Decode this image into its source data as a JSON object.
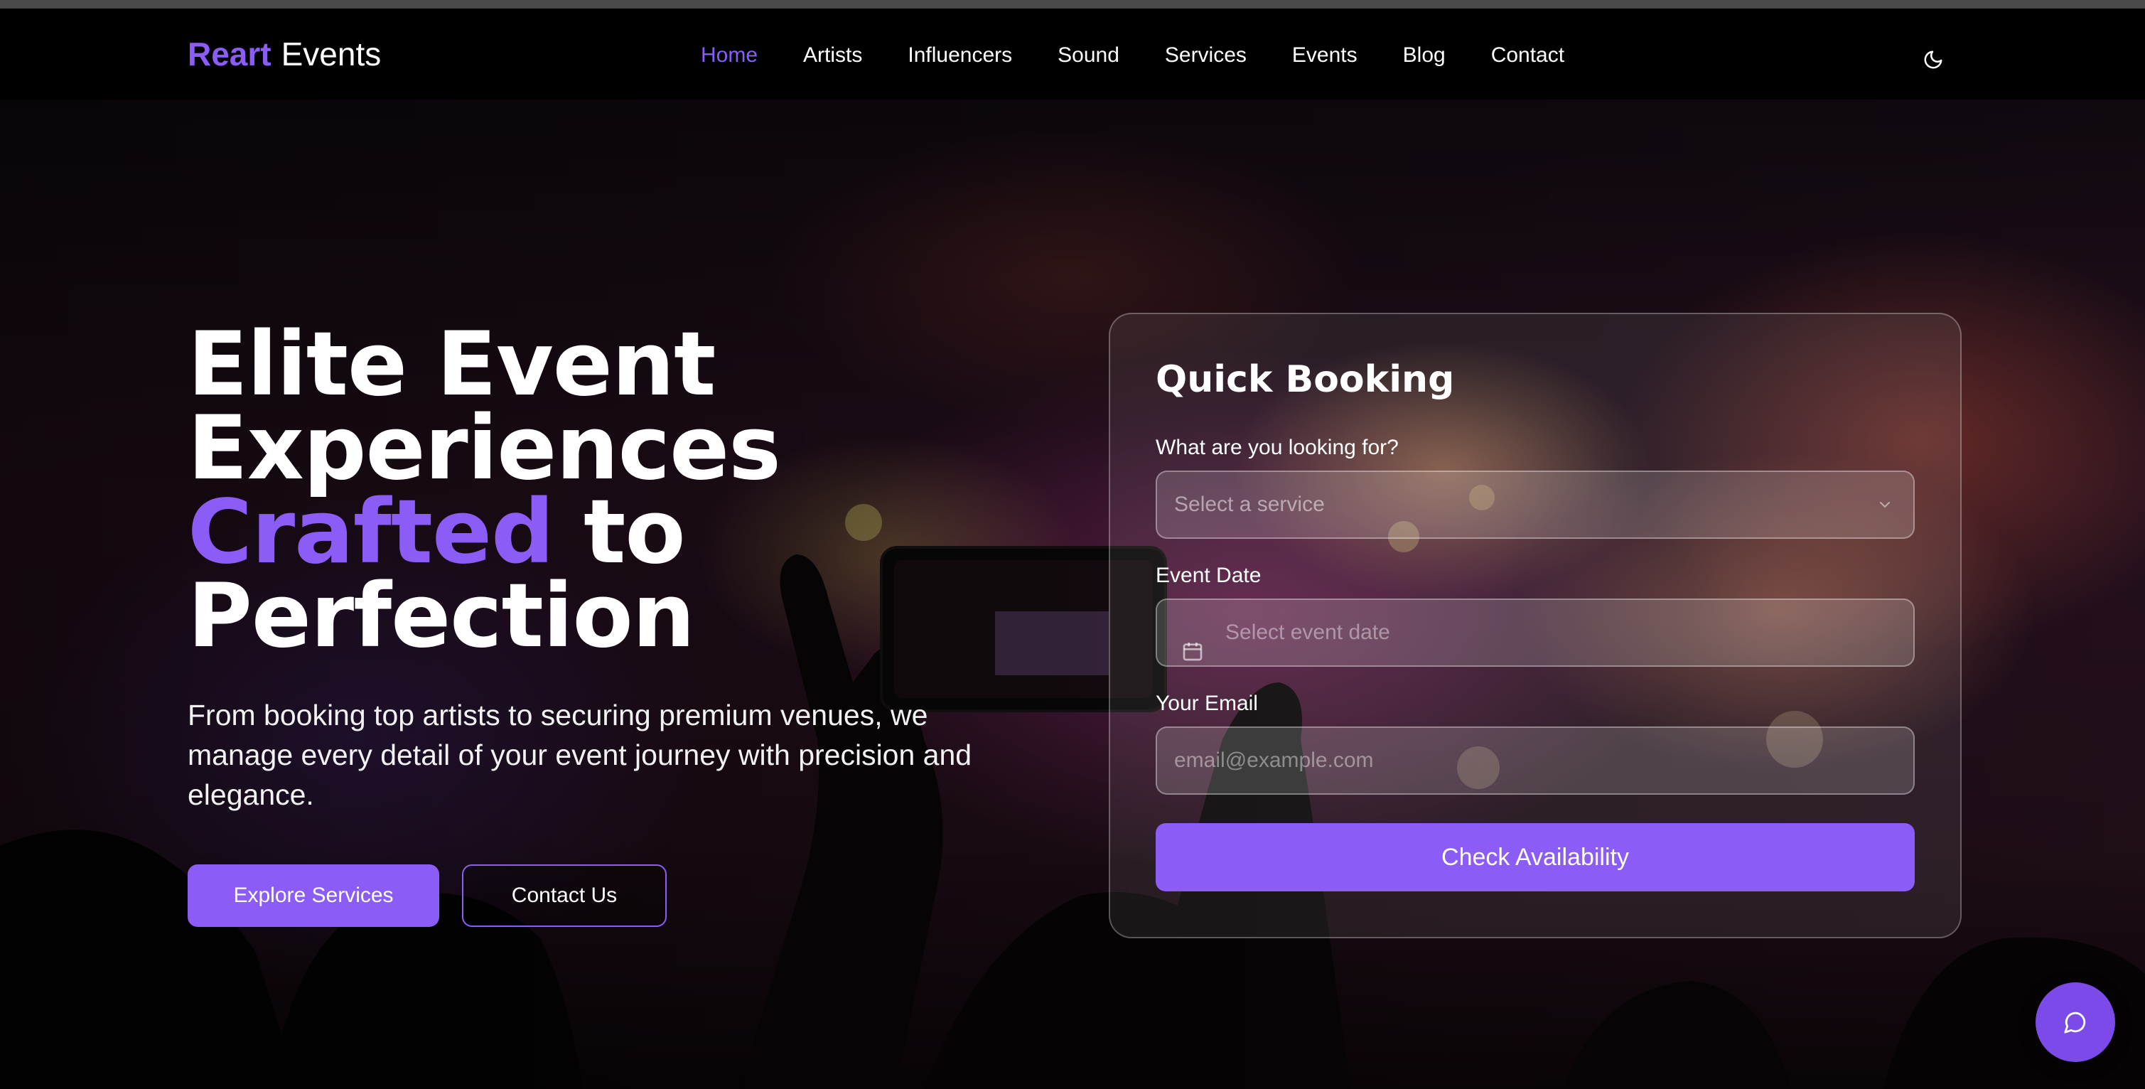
{
  "brand": {
    "name": "Reart",
    "suffix": "Events"
  },
  "nav": {
    "items": [
      {
        "label": "Home",
        "active": true
      },
      {
        "label": "Artists"
      },
      {
        "label": "Influencers"
      },
      {
        "label": "Sound"
      },
      {
        "label": "Services"
      },
      {
        "label": "Events"
      },
      {
        "label": "Blog"
      },
      {
        "label": "Contact"
      }
    ],
    "theme_toggle_icon": "moon-icon"
  },
  "hero": {
    "title_line1": "Elite Event",
    "title_line2": "Experiences",
    "title_accent": "Crafted",
    "title_after_accent": "to",
    "title_line4": "Perfection",
    "subtitle": "From booking top artists to securing premium venues, we manage every detail of your event journey with precision and elegance.",
    "primary_cta": "Explore Services",
    "secondary_cta": "Contact Us"
  },
  "booking": {
    "title": "Quick Booking",
    "service_label": "What are you looking for?",
    "service_placeholder": "Select a service",
    "date_label": "Event Date",
    "date_placeholder": "Select event date",
    "email_label": "Your Email",
    "email_placeholder": "email@example.com",
    "submit_label": "Check Availability"
  },
  "chat": {
    "icon": "chat-bubble-icon"
  },
  "colors": {
    "accent": "#8b5cf6",
    "nav_bg": "#000000",
    "text": "#ffffff"
  }
}
